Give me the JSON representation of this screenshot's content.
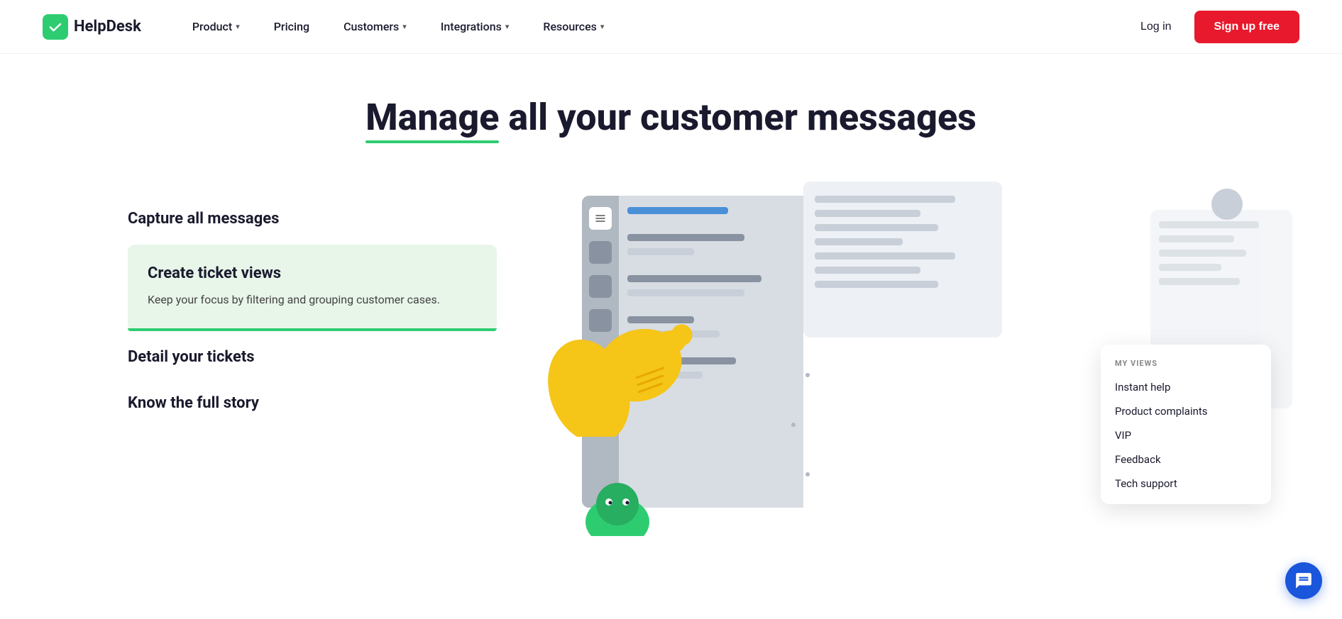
{
  "brand": {
    "name": "HelpDesk",
    "logo_alt": "HelpDesk logo"
  },
  "nav": {
    "links": [
      {
        "label": "Product",
        "has_dropdown": true
      },
      {
        "label": "Pricing",
        "has_dropdown": false
      },
      {
        "label": "Customers",
        "has_dropdown": true
      },
      {
        "label": "Integrations",
        "has_dropdown": true
      },
      {
        "label": "Resources",
        "has_dropdown": true
      }
    ],
    "login_label": "Log in",
    "signup_label": "Sign up free"
  },
  "hero": {
    "title_part1": "Manage",
    "title_part2": " all your customer messages"
  },
  "features": {
    "heading1": "Capture all messages",
    "active_card": {
      "title": "Create ticket views",
      "description": "Keep your focus by filtering and grouping customer cases."
    },
    "heading2": "Detail your tickets",
    "heading3": "Know the full story"
  },
  "my_views": {
    "header": "MY VIEWS",
    "items": [
      "Instant help",
      "Product complaints",
      "VIP",
      "Feedback",
      "Tech support"
    ]
  },
  "colors": {
    "brand_green": "#2ecc71",
    "brand_red": "#e8192c",
    "brand_blue": "#1a56db",
    "text_dark": "#1a1a2e"
  }
}
